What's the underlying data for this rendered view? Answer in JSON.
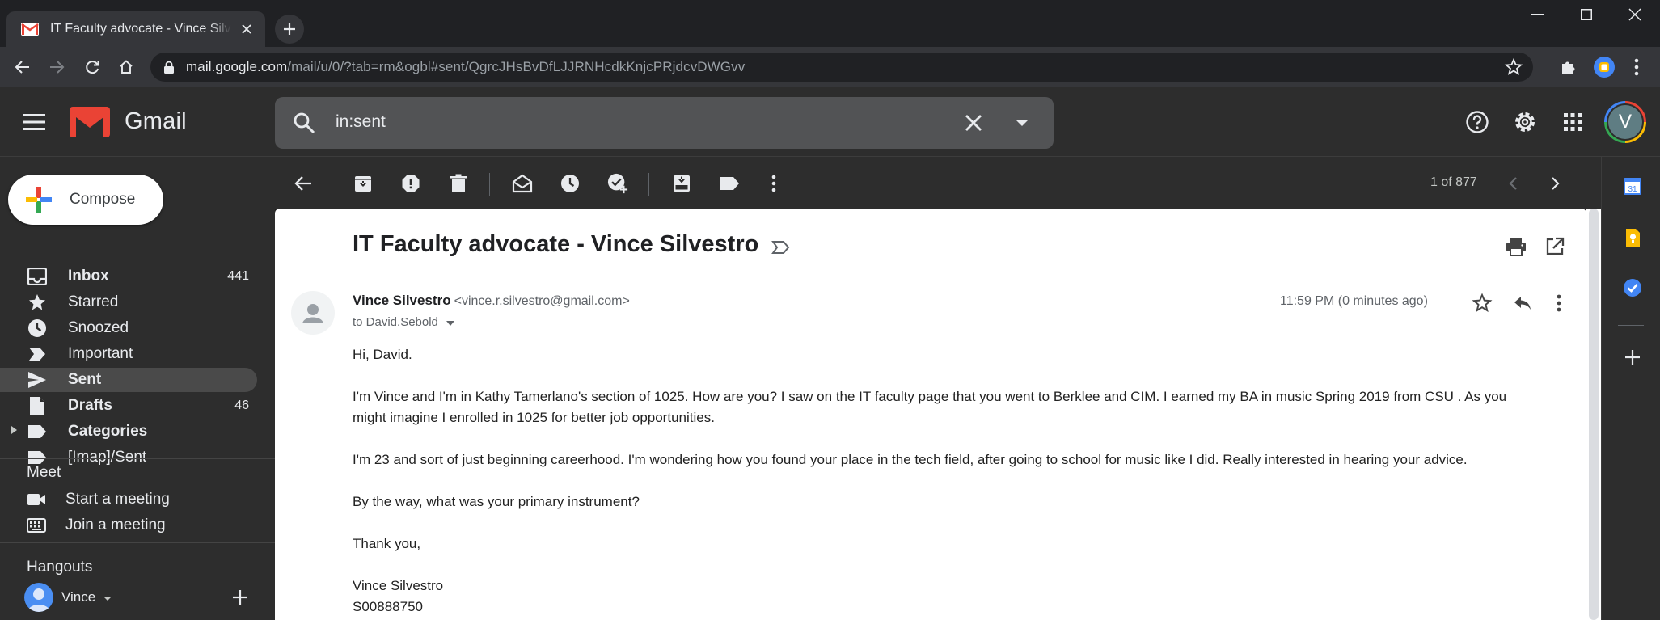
{
  "browser": {
    "tab_title": "IT Faculty advocate - Vince Silvestro - vince.r.silvestro@gmail.com - Gmail",
    "url_host": "mail.google.com",
    "url_path": "/mail/u/0/?tab=rm&ogbl#sent/QgrcJHsBvDfLJJRNHcdkKnjcPRjdcvDWGvv"
  },
  "header": {
    "app_name": "Gmail",
    "search_value": "in:sent",
    "account_initial": "V"
  },
  "compose_label": "Compose",
  "nav": [
    {
      "label": "Inbox",
      "count": "441",
      "bold": true,
      "icon": "inbox-icon"
    },
    {
      "label": "Starred",
      "count": "",
      "bold": false,
      "icon": "star-icon"
    },
    {
      "label": "Snoozed",
      "count": "",
      "bold": false,
      "icon": "clock-icon"
    },
    {
      "label": "Important",
      "count": "",
      "bold": false,
      "icon": "important-icon"
    },
    {
      "label": "Sent",
      "count": "",
      "bold": true,
      "icon": "send-icon",
      "active": true
    },
    {
      "label": "Drafts",
      "count": "46",
      "bold": true,
      "icon": "draft-icon"
    },
    {
      "label": "Categories",
      "count": "",
      "bold": true,
      "icon": "label-icon"
    },
    {
      "label": "[Imap]/Sent",
      "count": "",
      "bold": false,
      "icon": "label-icon"
    }
  ],
  "meet": {
    "title": "Meet",
    "start": "Start a meeting",
    "join": "Join a meeting"
  },
  "hangouts": {
    "title": "Hangouts",
    "user": "Vince"
  },
  "pager": "1 of 877",
  "email": {
    "subject": "IT Faculty advocate - Vince Silvestro",
    "sender_name": "Vince Silvestro",
    "sender_email": "<vince.r.silvestro@gmail.com>",
    "to": "to David.Sebold",
    "time": "11:59 PM (0 minutes ago)",
    "body": [
      "Hi, David.",
      "I'm Vince and I'm in Kathy Tamerlano's section of 1025. How are you? I saw on the IT faculty page that you went to Berklee and CIM. I earned my BA in music Spring 2019 from CSU . As you might imagine I enrolled in 1025 for better job opportunities.",
      "I'm 23 and sort of just beginning careerhood. I'm wondering how you found your place in the tech field, after going to school for music like I did. Really interested in hearing your advice.",
      "By the way, what was your primary instrument?",
      "Thank you,"
    ],
    "signature": [
      "Vince Silvestro",
      "S00888750"
    ]
  },
  "colors": {
    "chrome_bg": "#202124",
    "gmail_dark": "#2d2d2d",
    "active_nav": "#4a4a4a",
    "gmail_red": "#ea4335"
  }
}
